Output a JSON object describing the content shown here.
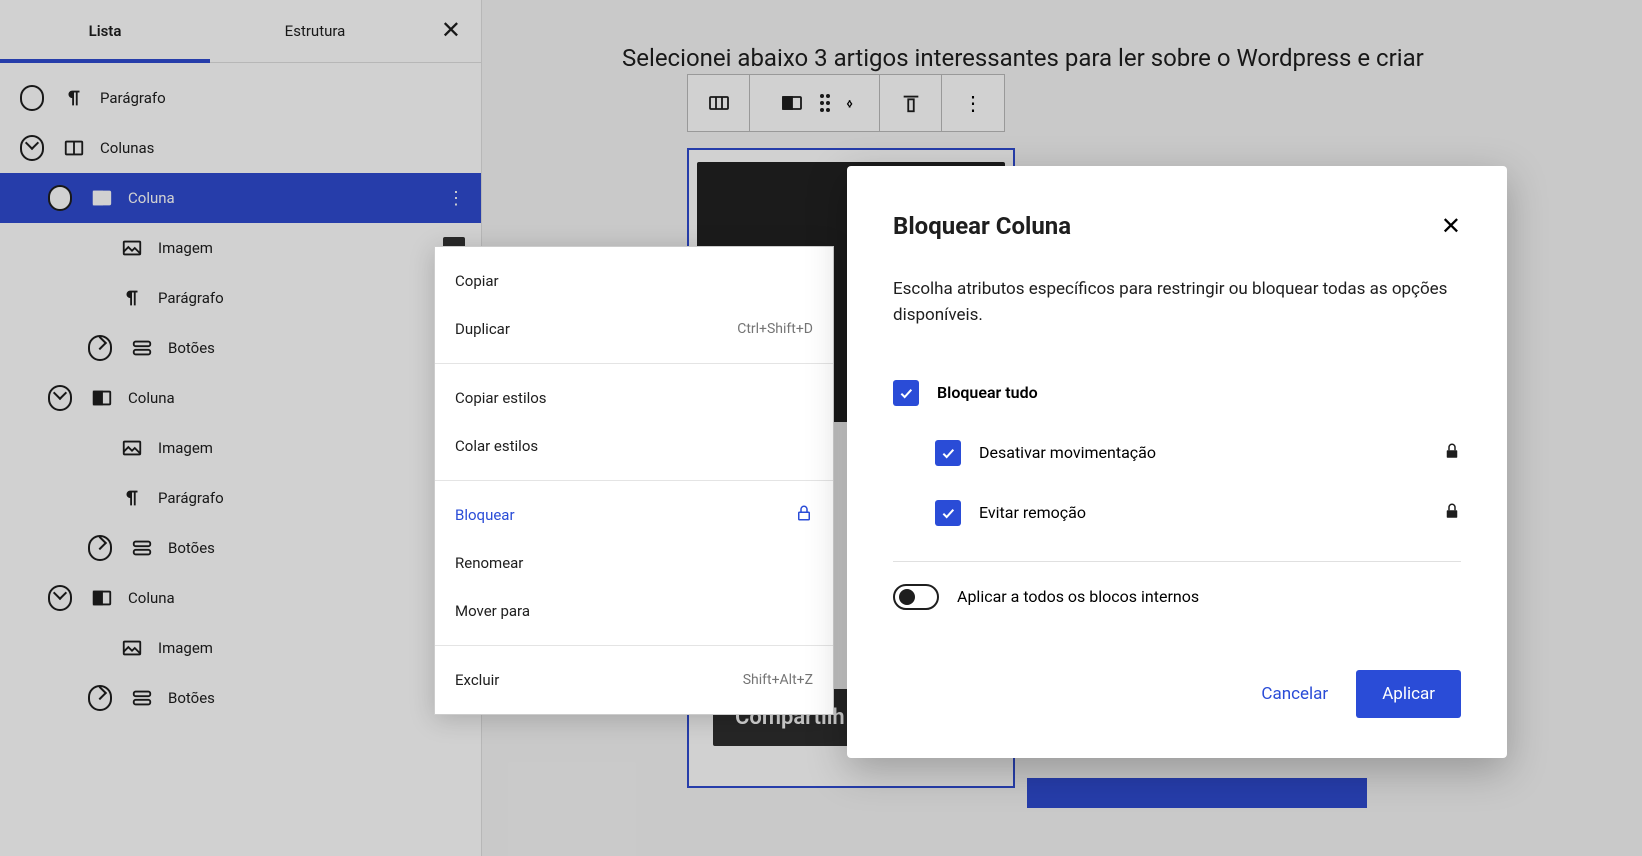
{
  "tabs": {
    "list": "Lista",
    "structure": "Estrutura"
  },
  "tree": {
    "paragraph": "Parágrafo",
    "columns": "Colunas",
    "column": "Coluna",
    "image": "Imagem",
    "buttons": "Botões"
  },
  "canvas": {
    "intro": "Selecionei abaixo 3 artigos interessantes para ler sobre o Wordpress e criar",
    "share": "Compartilh"
  },
  "menu": {
    "copy": "Copiar",
    "duplicate": "Duplicar",
    "duplicate_shortcut": "Ctrl+Shift+D",
    "copy_styles": "Copiar estilos",
    "paste_styles": "Colar estilos",
    "lock": "Bloquear",
    "rename": "Renomear",
    "move_to": "Mover para",
    "delete": "Excluir",
    "delete_shortcut": "Shift+Alt+Z"
  },
  "modal": {
    "title": "Bloquear Coluna",
    "desc": "Escolha atributos específicos para restringir ou bloquear todas as opções disponíveis.",
    "lock_all": "Bloquear tudo",
    "disable_move": "Desativar movimentação",
    "prevent_removal": "Evitar remoção",
    "apply_inner": "Aplicar a todos os blocos internos",
    "cancel": "Cancelar",
    "apply": "Aplicar"
  }
}
